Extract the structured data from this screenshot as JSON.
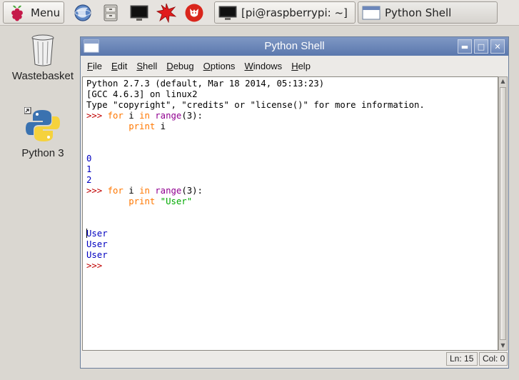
{
  "panel": {
    "menu_label": "Menu",
    "launchers": [
      "globe-icon",
      "file-manager-icon",
      "terminal-icon",
      "burst-icon",
      "wolfram-icon"
    ],
    "tasks": [
      {
        "label": "[pi@raspberrypi: ~]",
        "icon": "terminal-icon"
      },
      {
        "label": "Python Shell",
        "icon": "window-icon"
      }
    ]
  },
  "desktop": {
    "icons": [
      {
        "label": "Wastebasket",
        "icon": "trash-icon"
      },
      {
        "label": "Python 3",
        "icon": "python-icon"
      }
    ]
  },
  "window": {
    "title": "Python Shell",
    "menus": [
      "File",
      "Edit",
      "Shell",
      "Debug",
      "Options",
      "Windows",
      "Help"
    ],
    "status": {
      "line": "Ln: 15",
      "col": "Col: 0"
    }
  },
  "shell": {
    "banner1": "Python 2.7.3 (default, Mar 18 2014, 05:13:23)",
    "banner2": "[GCC 4.6.3] on linux2",
    "banner3": "Type \"copyright\", \"credits\" or \"license()\" for more information.",
    "prompt": ">>> ",
    "kw_for": "for",
    "var_i": " i ",
    "kw_in": "in",
    "fn_range": "range",
    "args": "(3):",
    "indent": "        ",
    "kw_print": "print",
    "print_var": " i",
    "str_user": "\"User\"",
    "out_0": "0",
    "out_1": "1",
    "out_2": "2",
    "out_user": "User",
    "out_user_rest": "ser",
    "out_user_first": "U",
    "final_prompt": ">>>"
  }
}
